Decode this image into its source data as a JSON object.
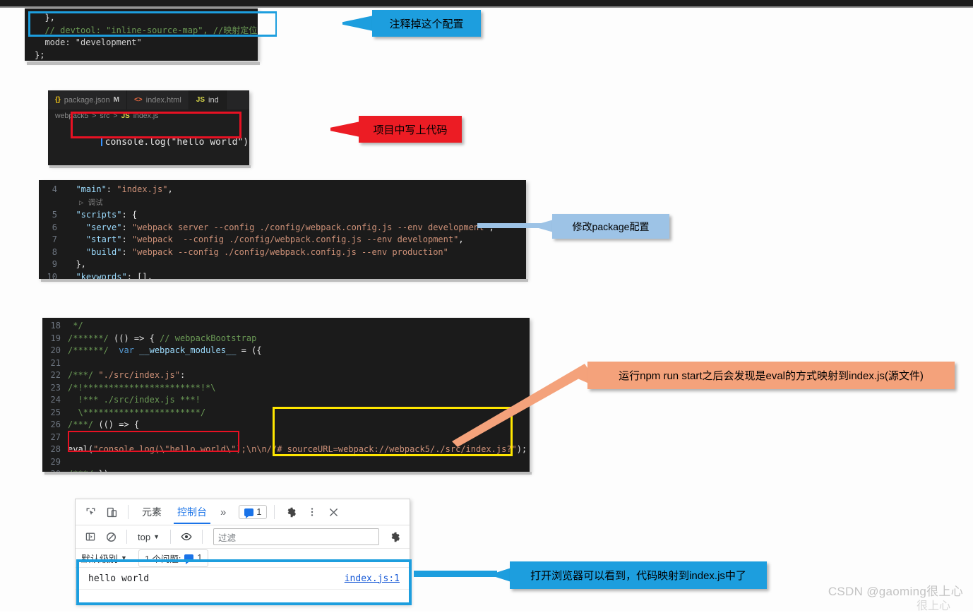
{
  "watermark": {
    "text": "CSDN @gaoming很上心",
    "text2": "很上心"
  },
  "panels": {
    "webpack_config": {
      "name": "webpack.config.js snippet",
      "lines": [
        {
          "segments": [
            {
              "t": "  },",
              "c": "k-white"
            }
          ]
        },
        {
          "segments": [
            {
              "t": "  // devtool: \"inline-source-map\", //映射定位er",
              "c": "k-com"
            }
          ]
        },
        {
          "segments": [
            {
              "t": "  mode: \"development\"",
              "c": "k-plain"
            }
          ]
        },
        {
          "segments": [
            {
              "t": "};",
              "c": "k-white"
            }
          ]
        }
      ]
    },
    "editor": {
      "tabs": [
        {
          "icon": "json-braces-icon",
          "icon_text": "{}",
          "label": "package.json",
          "modified": "M",
          "active": false
        },
        {
          "icon": "html-tag-icon",
          "icon_text": "<>",
          "label": "index.html",
          "modified": "",
          "active": false
        },
        {
          "icon": "js-icon",
          "icon_text": "JS",
          "label": "ind",
          "modified": "",
          "active": true
        }
      ],
      "breadcrumb": [
        "webpack5",
        "src",
        "index.js"
      ],
      "breadcrumb_icon": "js-icon",
      "breadcrumb_sep": ">",
      "code_line": "console.log(\"hello world\");"
    },
    "package_json": {
      "lines": [
        {
          "no": "4",
          "segments": [
            {
              "t": "  \"main\"",
              "c": "k-key"
            },
            {
              "t": ": ",
              "c": "k-white"
            },
            {
              "t": "\"index.js\"",
              "c": "k-str"
            },
            {
              "t": ",",
              "c": "k-white"
            }
          ]
        },
        {
          "no": "",
          "segments": [
            {
              "t": "   ▷ 调试",
              "c": "codelens"
            }
          ]
        },
        {
          "no": "5",
          "segments": [
            {
              "t": "  \"scripts\"",
              "c": "k-key"
            },
            {
              "t": ": {",
              "c": "k-white"
            }
          ]
        },
        {
          "no": "6",
          "segments": [
            {
              "t": "    \"serve\"",
              "c": "k-key"
            },
            {
              "t": ": ",
              "c": "k-white"
            },
            {
              "t": "\"webpack server --config ./config/webpack.config.js --env development\"",
              "c": "k-str"
            },
            {
              "t": ",",
              "c": "k-white"
            }
          ]
        },
        {
          "no": "7",
          "segments": [
            {
              "t": "    \"start\"",
              "c": "k-key"
            },
            {
              "t": ": ",
              "c": "k-white"
            },
            {
              "t": "\"webpack  --config ./config/webpack.config.js --env development\"",
              "c": "k-str"
            },
            {
              "t": ",",
              "c": "k-white"
            }
          ]
        },
        {
          "no": "8",
          "segments": [
            {
              "t": "    \"build\"",
              "c": "k-key"
            },
            {
              "t": ": ",
              "c": "k-white"
            },
            {
              "t": "\"webpack --config ./config/webpack.config.js --env production\"",
              "c": "k-str"
            }
          ]
        },
        {
          "no": "9",
          "segments": [
            {
              "t": "  },",
              "c": "k-white"
            }
          ]
        },
        {
          "no": "10",
          "segments": [
            {
              "t": "  \"keywords\"",
              "c": "k-key"
            },
            {
              "t": ": [],",
              "c": "k-white"
            }
          ]
        }
      ]
    },
    "bundle_output": {
      "lines": [
        {
          "no": "18",
          "segments": [
            {
              "t": " */",
              "c": "k-com"
            }
          ]
        },
        {
          "no": "19",
          "segments": [
            {
              "t": "/******/ ",
              "c": "k-com"
            },
            {
              "t": "(() => { ",
              "c": "k-white"
            },
            {
              "t": "// webpackBootstrap",
              "c": "k-com"
            }
          ]
        },
        {
          "no": "20",
          "segments": [
            {
              "t": "/******/ ",
              "c": "k-com"
            },
            {
              "t": " var ",
              "c": "k-kw"
            },
            {
              "t": "__webpack_modules__",
              "c": "k-key"
            },
            {
              "t": " = ({",
              "c": "k-white"
            }
          ]
        },
        {
          "no": "21",
          "segments": [
            {
              "t": "",
              "c": "k-white"
            }
          ]
        },
        {
          "no": "22",
          "segments": [
            {
              "t": "/***/ ",
              "c": "k-com"
            },
            {
              "t": "\"./src/index.js\"",
              "c": "k-str"
            },
            {
              "t": ":",
              "c": "k-white"
            }
          ]
        },
        {
          "no": "23",
          "segments": [
            {
              "t": "/*!***********************!*\\",
              "c": "k-com"
            }
          ]
        },
        {
          "no": "24",
          "segments": [
            {
              "t": "  !*** ./src/index.js ***!",
              "c": "k-com"
            }
          ]
        },
        {
          "no": "25",
          "segments": [
            {
              "t": "  \\***********************/",
              "c": "k-com"
            }
          ]
        },
        {
          "no": "26",
          "segments": [
            {
              "t": "/***/ ",
              "c": "k-com"
            },
            {
              "t": "(() => {",
              "c": "k-white"
            }
          ]
        },
        {
          "no": "27",
          "segments": [
            {
              "t": "",
              "c": "k-white"
            }
          ]
        },
        {
          "no": "28",
          "segments": [
            {
              "t": "eval",
              "c": "k-white"
            },
            {
              "t": "(",
              "c": "k-white"
            },
            {
              "t": "\"console.log(\\\"hello world\\\");\\n\\n//# sourceURL=webpack://webpack5/./src/index.js?\"",
              "c": "k-str"
            },
            {
              "t": ");",
              "c": "k-white"
            }
          ]
        },
        {
          "no": "29",
          "segments": [
            {
              "t": "",
              "c": "k-white"
            }
          ]
        },
        {
          "no": "30",
          "segments": [
            {
              "t": "/***/ ",
              "c": "k-com"
            },
            {
              "t": "})",
              "c": "k-white"
            }
          ]
        }
      ]
    }
  },
  "devtools": {
    "toolbar": {
      "inspect_icon": "inspect-element-icon",
      "device_icon": "device-toolbar-icon",
      "tabs": [
        {
          "label": "元素",
          "active": false
        },
        {
          "label": "控制台",
          "active": true
        }
      ],
      "more_tabs": "»",
      "issues_badge_count": "1",
      "issues_badge_icon": "message-icon",
      "settings_icon": "gear-icon",
      "kebab_icon": "more-vertical-icon",
      "close_icon": "close-icon"
    },
    "console_bar": {
      "sidebar_icon": "console-sidebar-icon",
      "clear_icon": "clear-console-icon",
      "context_value": "top",
      "context_caret": "▼",
      "eye_icon": "live-expression-icon",
      "filter_placeholder": "过滤",
      "settings_icon": "gear-icon"
    },
    "levels_bar": {
      "level_label": "默认级别",
      "level_caret": "▼",
      "issues_label": "1 个问题:",
      "issues_count": "1",
      "issues_icon": "message-icon"
    },
    "log": {
      "message": "hello world",
      "source": "index.js:1"
    }
  },
  "callouts": [
    {
      "id": "co-1",
      "text": "注释掉这个配置",
      "color": "#1d9ede"
    },
    {
      "id": "co-2",
      "text": "项目中写上代码",
      "color": "#ec1c24"
    },
    {
      "id": "co-3",
      "text": "修改package配置",
      "color": "#9dc3e6"
    },
    {
      "id": "co-4",
      "text": "运行npm run start之后会发现是eval的方式映射到index.js(源文件)",
      "color": "#f4a27b"
    },
    {
      "id": "co-5",
      "text": "打开浏览器可以看到，代码映射到index.js中了",
      "color": "#1d9ede"
    }
  ],
  "highlights": [
    {
      "id": "hl-config",
      "color": "#1d9ede",
      "target": "devtool-comment-line"
    },
    {
      "id": "hl-editor",
      "color": "#e81123",
      "target": "console-log-line"
    },
    {
      "id": "hl-eval",
      "color": "#e81123",
      "target": "eval-call"
    },
    {
      "id": "hl-sourceurl",
      "color": "#ffe600",
      "target": "sourceurl-comment"
    },
    {
      "id": "hl-console",
      "color": "#1d9ede",
      "target": "console-output-row"
    }
  ]
}
